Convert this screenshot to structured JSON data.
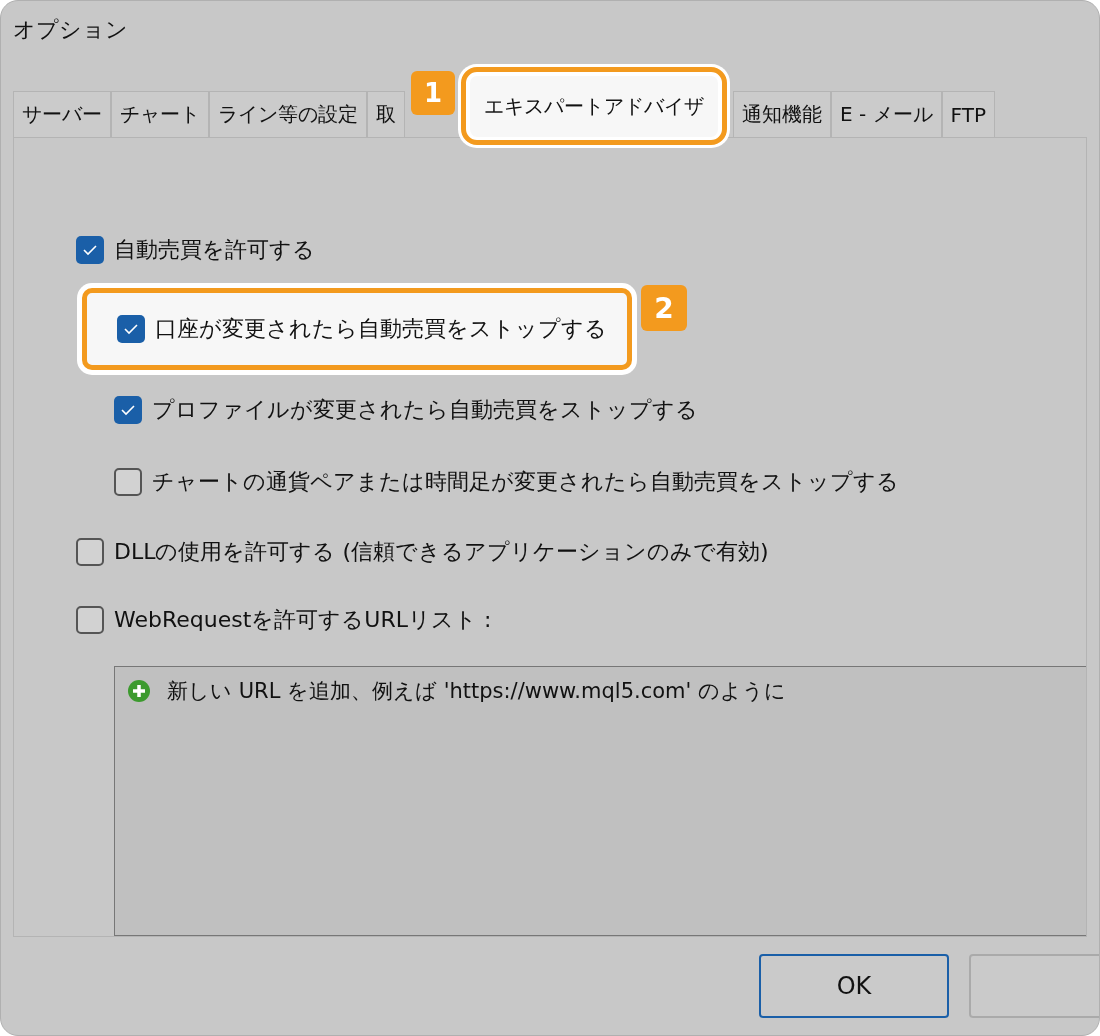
{
  "window": {
    "title": "オプション"
  },
  "tabs": [
    {
      "label": "サーバー",
      "selected": false
    },
    {
      "label": "チャート",
      "selected": false
    },
    {
      "label": "ライン等の設定",
      "selected": false
    },
    {
      "label": "取",
      "selected": false
    },
    {
      "label": "エキスパートアドバイザ",
      "selected": true,
      "callout": "1"
    },
    {
      "label": "通知機能",
      "selected": false
    },
    {
      "label": "E - メール",
      "selected": false
    },
    {
      "label": "FTP",
      "selected": false
    }
  ],
  "options": [
    {
      "label": "自動売買を許可する",
      "checked": true,
      "children": [
        {
          "label": "口座が変更されたら自動売買をストップする",
          "checked": true,
          "callout": "2"
        },
        {
          "label": "プロファイルが変更されたら自動売買をストップする",
          "checked": true
        },
        {
          "label": "チャートの通貨ペアまたは時間足が変更されたら自動売買をストップする",
          "checked": false
        }
      ]
    },
    {
      "label": "DLLの使用を許可する (信頼できるアプリケーションのみで有効)",
      "checked": false
    },
    {
      "label": "WebRequestを許可するURLリスト :",
      "checked": false
    }
  ],
  "url_list": {
    "items": [
      "新しい URL を追加、例えば 'https://www.mql5.com' のように"
    ]
  },
  "buttons": {
    "ok": "OK"
  }
}
